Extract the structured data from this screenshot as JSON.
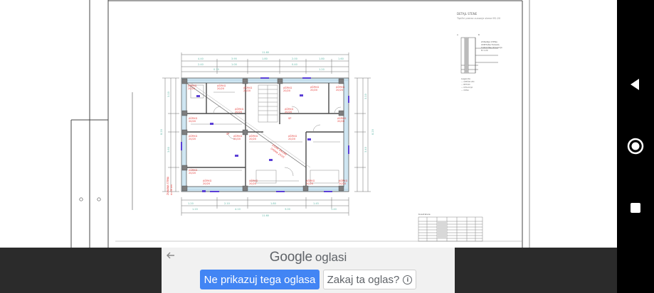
{
  "ad": {
    "brand": "Google",
    "title_suffix": "oglasi",
    "primary_button": "Ne prikazuj tega oglasa",
    "secondary_button": "Zakaj ta oglas?"
  },
  "drawing": {
    "detail_title": "DETAJL STENE",
    "detail_subtitle": "Tipični prerez zunanje stene M1:20",
    "legend_heading": "Legenda",
    "table_heading": "Kvadrature"
  },
  "icons": {
    "back_arrow": "arrow-left-icon",
    "info": "info-icon",
    "nav_back": "triangle-back-icon",
    "nav_home": "circle-home-icon",
    "nav_recents": "square-recents-icon"
  },
  "colors": {
    "ad_button": "#4285f4",
    "wall_fill": "#cfe6f2",
    "annotation_red": "#e53935",
    "dimension_teal": "#5fb7a8",
    "window_purple": "#5b3fd6",
    "ad_strip_bg": "#2b2b2b",
    "ad_panel_bg": "#f1f1f1"
  }
}
